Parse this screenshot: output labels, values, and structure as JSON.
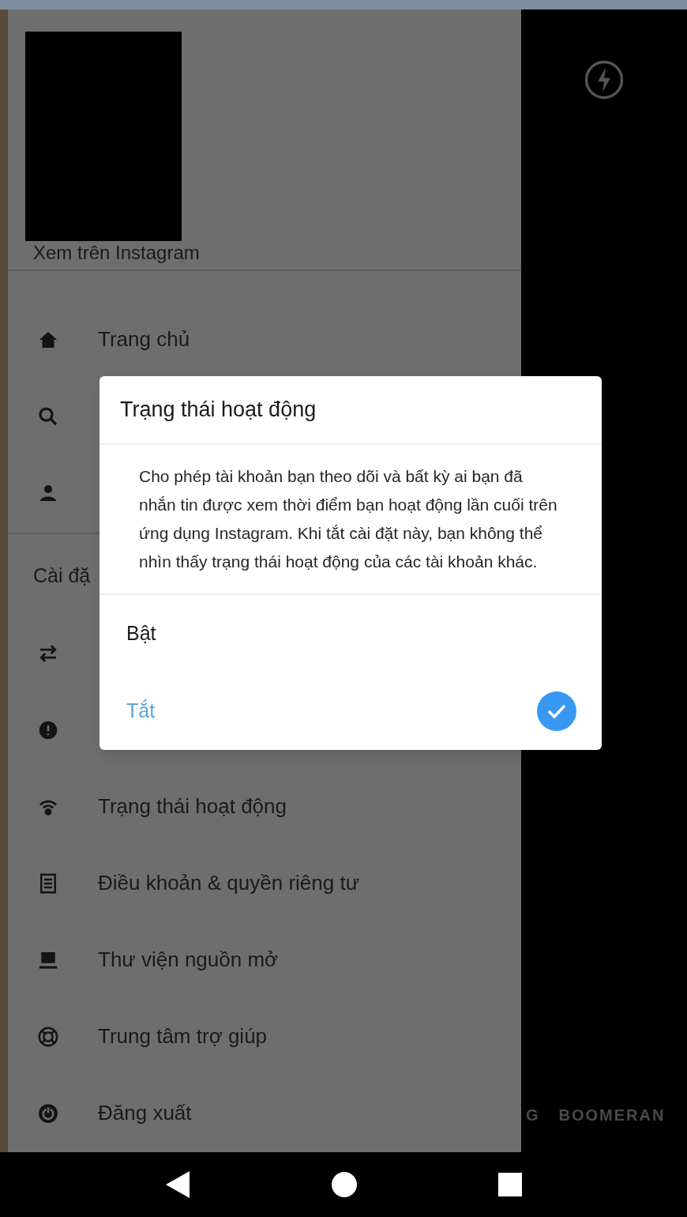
{
  "drawer": {
    "subtitle": "Xem trên Instagram",
    "items": [
      {
        "kind": "home",
        "label": "Trang chủ"
      },
      {
        "kind": "search"
      },
      {
        "kind": "person"
      }
    ],
    "section_heading": "Cài đặ",
    "settings_items": [
      {
        "kind": "swap"
      },
      {
        "kind": "info"
      },
      {
        "kind": "activity",
        "label": "Trạng thái hoạt động"
      },
      {
        "kind": "document",
        "label": "Điều khoản & quyền riêng tư"
      },
      {
        "kind": "laptop",
        "label": "Thư viện nguồn mở"
      },
      {
        "kind": "lifebuoy",
        "label": "Trung tâm trợ giúp"
      },
      {
        "kind": "power",
        "label": "Đăng xuất"
      }
    ]
  },
  "camera": {
    "modes": [
      "G",
      "BOOMERAN"
    ]
  },
  "dialog": {
    "title": "Trạng thái hoạt động",
    "body": "Cho phép tài khoản bạn theo dõi và bất kỳ ai bạn đã nhắn tin được xem thời điểm bạn hoạt động lần cuối trên ứng dụng Instagram. Khi tắt cài đặt này, bạn không thể nhìn thấy trạng thái hoạt động của các tài khoản khác.",
    "options": [
      {
        "label": "Bật",
        "selected": false
      },
      {
        "label": "Tắt",
        "selected": true
      }
    ]
  }
}
